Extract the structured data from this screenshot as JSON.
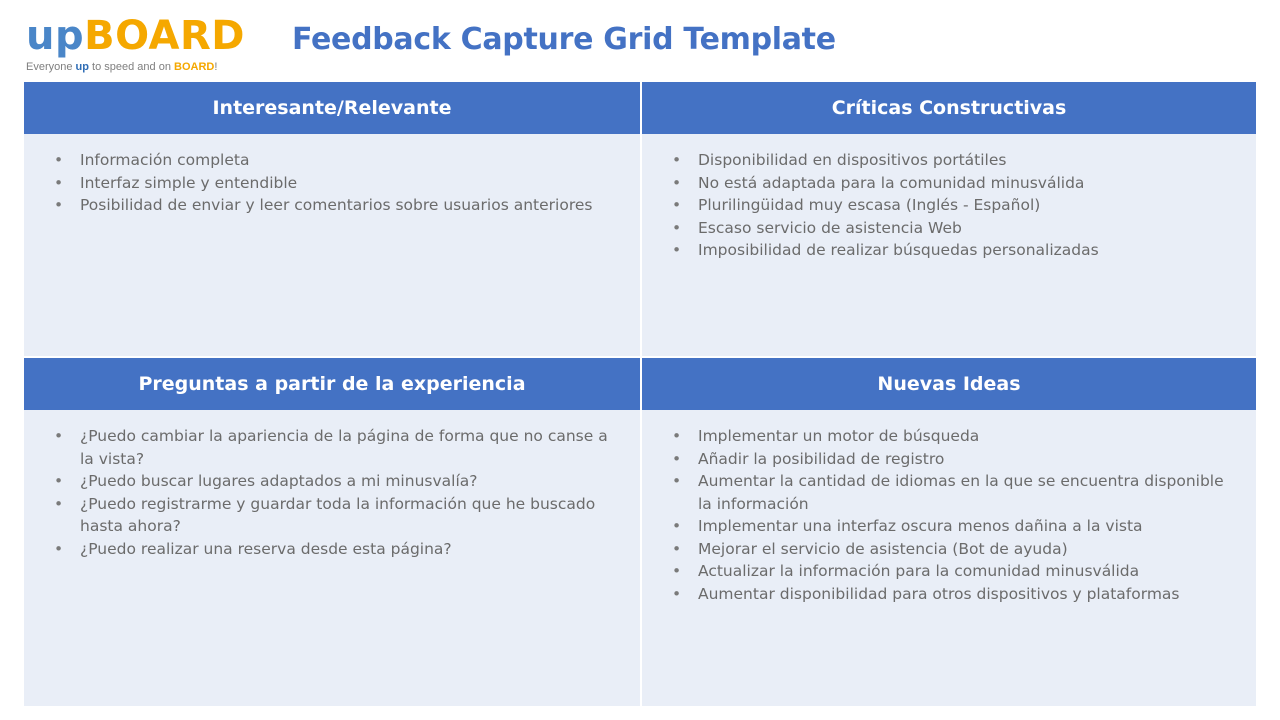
{
  "logo": {
    "up": "up",
    "board": "BOARD",
    "tagline_prefix": "Everyone ",
    "tagline_up": "up",
    "tagline_middle": " to speed and on ",
    "tagline_board": "BOARD",
    "tagline_end": "!"
  },
  "title": "Feedback Capture Grid Template",
  "colors": {
    "header_bg": "#4472c4",
    "body_bg": "#e9eef7",
    "title": "#4472c4",
    "logo_blue": "#4a86c8",
    "logo_orange": "#f5a800"
  },
  "quadrants": [
    {
      "header": "Interesante/Relevante",
      "items": [
        "Información completa",
        "Interfaz simple y entendible",
        "Posibilidad de enviar y leer comentarios sobre usuarios anteriores"
      ]
    },
    {
      "header": "Críticas Constructivas",
      "items": [
        "Disponibilidad en dispositivos portátiles",
        "No está adaptada para la comunidad minusválida",
        "Plurilingüidad muy escasa (Inglés - Español)",
        "Escaso servicio de asistencia Web",
        "Imposibilidad de realizar búsquedas personalizadas"
      ]
    },
    {
      "header": "Preguntas a partir de la experiencia",
      "items": [
        "¿Puedo cambiar la apariencia de la página de forma que no canse a la vista?",
        "¿Puedo buscar lugares adaptados a mi minusvalía?",
        "¿Puedo registrarme y guardar toda la información que he buscado hasta ahora?",
        "¿Puedo realizar una reserva desde esta página?"
      ]
    },
    {
      "header": "Nuevas Ideas",
      "items": [
        "Implementar un motor de búsqueda",
        "Añadir la posibilidad de registro",
        "Aumentar la cantidad de idiomas en la que se encuentra disponible la información",
        "Implementar una interfaz oscura menos dañina a la vista",
        "Mejorar el servicio de asistencia (Bot de ayuda)",
        "Actualizar la información para la comunidad minusválida",
        "Aumentar disponibilidad para otros dispositivos y plataformas"
      ]
    }
  ]
}
